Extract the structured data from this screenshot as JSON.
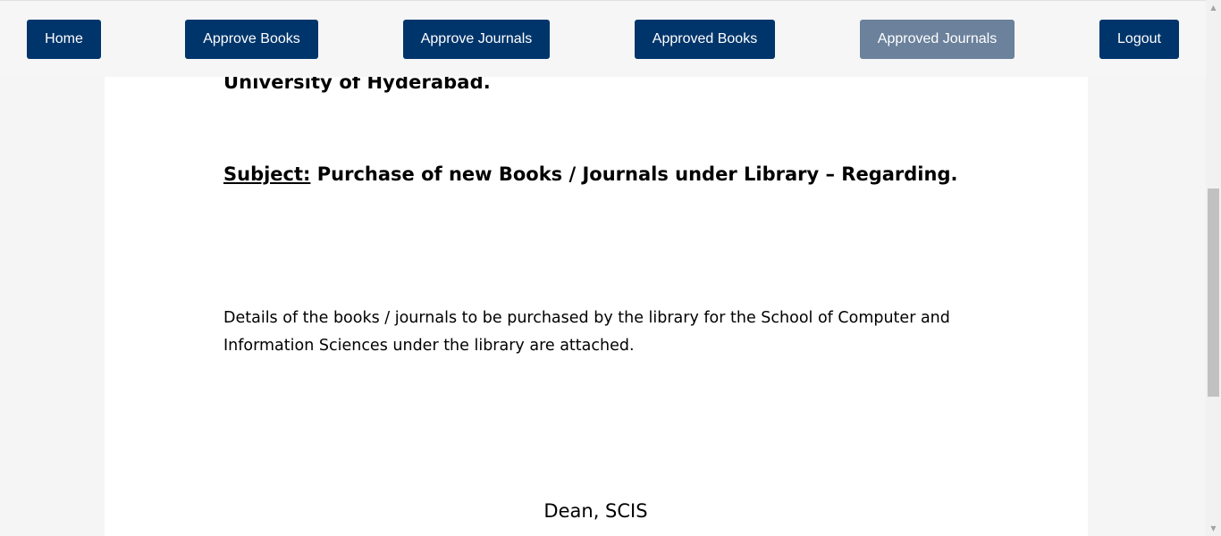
{
  "nav": {
    "home": "Home",
    "approve_books": "Approve Books",
    "approve_journals": "Approve Journals",
    "approved_books": "Approved Books",
    "approved_journals": "Approved Journals",
    "logout": "Logout",
    "active_item": "approved_journals"
  },
  "document": {
    "organization": "University of Hyderabad.",
    "subject_label": "Subject:",
    "subject_text": " Purchase of new Books / Journals under Library – Regarding.",
    "body": "Details of the books / journals to be purchased by the library for the School of Computer and Information Sciences under the library are attached.",
    "signature": "Dean, SCIS"
  },
  "colors": {
    "nav_button": "#00356b",
    "nav_button_active": "#6b819c",
    "page_background": "#f5f5f5",
    "document_background": "#ffffff"
  },
  "icons": {
    "scroll_up": "scroll-up-arrow-icon",
    "scroll_down": "scroll-down-arrow-icon"
  }
}
